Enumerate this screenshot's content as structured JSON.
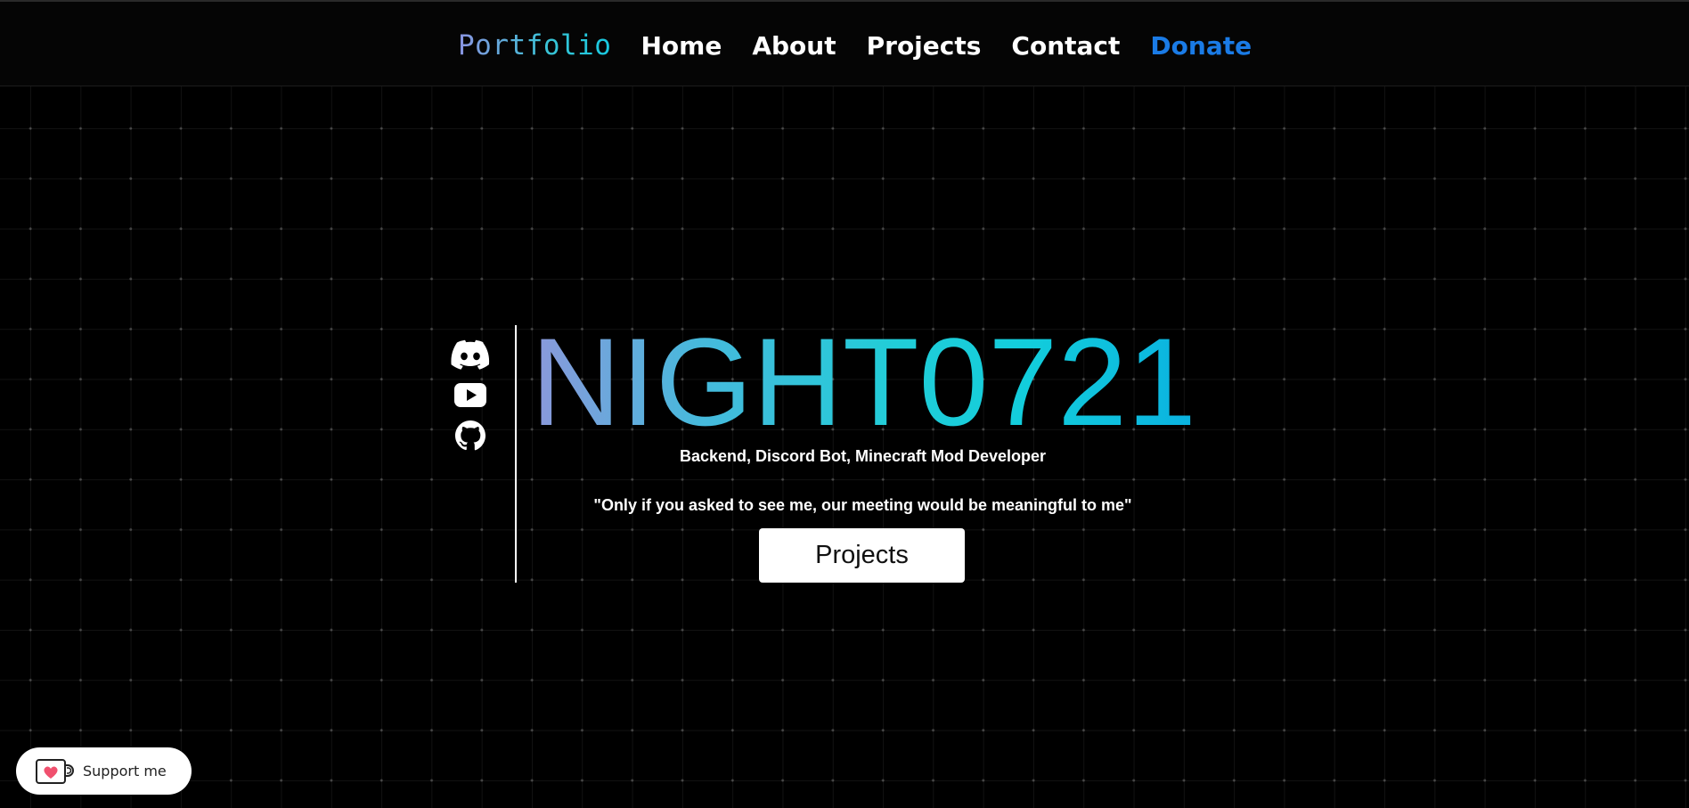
{
  "nav": {
    "brand": "Portfolio",
    "links": [
      {
        "label": "Home"
      },
      {
        "label": "About"
      },
      {
        "label": "Projects"
      },
      {
        "label": "Contact"
      }
    ],
    "donate": "Donate"
  },
  "social": {
    "icons": [
      "discord-icon",
      "youtube-icon",
      "github-icon"
    ]
  },
  "hero": {
    "title": "NIGHT0721",
    "subtitle": "Backend, Discord Bot, Minecraft Mod Developer",
    "quote": "\"Only if you asked to see me, our meeting would be meaningful to me\"",
    "button": "Projects"
  },
  "support": {
    "label": "Support me",
    "icon": "kofi-cup-icon"
  },
  "colors": {
    "background": "#000000",
    "donate": "#1a7be6",
    "gradient_start": "#8c98db",
    "gradient_end": "#0ab2e0"
  }
}
